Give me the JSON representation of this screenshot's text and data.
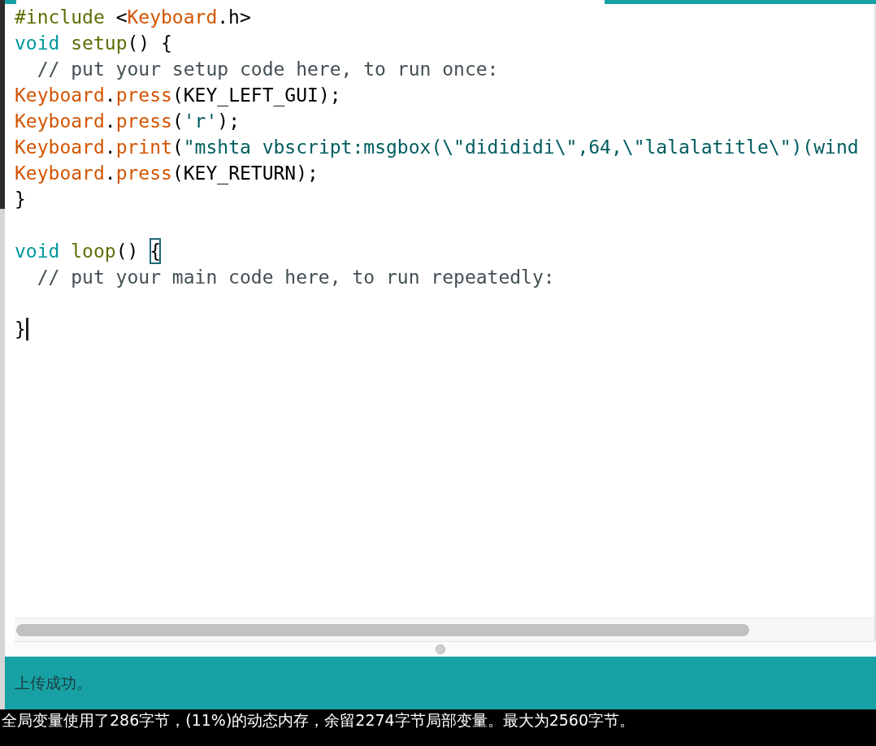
{
  "editor": {
    "lines": [
      {
        "kind": "code",
        "tokens": [
          {
            "kind": "preprocessor",
            "text": "#include"
          },
          {
            "kind": "plain",
            "text": " <"
          },
          {
            "kind": "class",
            "text": "Keyboard"
          },
          {
            "kind": "plain",
            "text": ".h>"
          }
        ]
      },
      {
        "kind": "code",
        "tokens": [
          {
            "kind": "keyword",
            "text": "void "
          },
          {
            "kind": "function",
            "text": "setup"
          },
          {
            "kind": "plain",
            "text": "() {"
          }
        ]
      },
      {
        "kind": "code",
        "tokens": [
          {
            "kind": "comment",
            "text": "  // put your setup code here, to run once:"
          }
        ]
      },
      {
        "kind": "code",
        "tokens": [
          {
            "kind": "class",
            "text": "Keyboard"
          },
          {
            "kind": "plain",
            "text": "."
          },
          {
            "kind": "class",
            "text": "press"
          },
          {
            "kind": "plain",
            "text": "(KEY_LEFT_GUI);"
          }
        ]
      },
      {
        "kind": "code",
        "tokens": [
          {
            "kind": "class",
            "text": "Keyboard"
          },
          {
            "kind": "plain",
            "text": "."
          },
          {
            "kind": "class",
            "text": "press"
          },
          {
            "kind": "plain",
            "text": "("
          },
          {
            "kind": "string",
            "text": "'r'"
          },
          {
            "kind": "plain",
            "text": ");"
          }
        ]
      },
      {
        "kind": "code",
        "tokens": [
          {
            "kind": "class",
            "text": "Keyboard"
          },
          {
            "kind": "plain",
            "text": "."
          },
          {
            "kind": "class",
            "text": "print"
          },
          {
            "kind": "plain",
            "text": "("
          },
          {
            "kind": "string",
            "text": "\"mshta vbscript:msgbox(\\\"didididi\\\",64,\\\"lalalatitle\\\")(wind"
          }
        ]
      },
      {
        "kind": "code",
        "tokens": [
          {
            "kind": "class",
            "text": "Keyboard"
          },
          {
            "kind": "plain",
            "text": "."
          },
          {
            "kind": "class",
            "text": "press"
          },
          {
            "kind": "plain",
            "text": "(KEY_RETURN);"
          }
        ]
      },
      {
        "kind": "code",
        "tokens": [
          {
            "kind": "plain",
            "text": "}"
          }
        ]
      },
      {
        "kind": "blank"
      },
      {
        "kind": "code",
        "tokens": [
          {
            "kind": "keyword",
            "text": "void "
          },
          {
            "kind": "function",
            "text": "loop"
          },
          {
            "kind": "plain",
            "text": "() "
          },
          {
            "kind": "matched_bracket",
            "text": "{"
          }
        ]
      },
      {
        "kind": "code",
        "tokens": [
          {
            "kind": "comment",
            "text": "  // put your main code here, to run repeatedly:"
          }
        ]
      },
      {
        "kind": "blank"
      },
      {
        "kind": "code",
        "tokens": [
          {
            "kind": "plain",
            "text": "}",
            "cursor_after": true
          }
        ]
      }
    ]
  },
  "status_bar": {
    "message": "上传成功。"
  },
  "console": {
    "lines": [
      "全局变量使用了286字节，(11%)的动态内存，余留2274字节局部变量。最大为2560字节。"
    ]
  }
}
